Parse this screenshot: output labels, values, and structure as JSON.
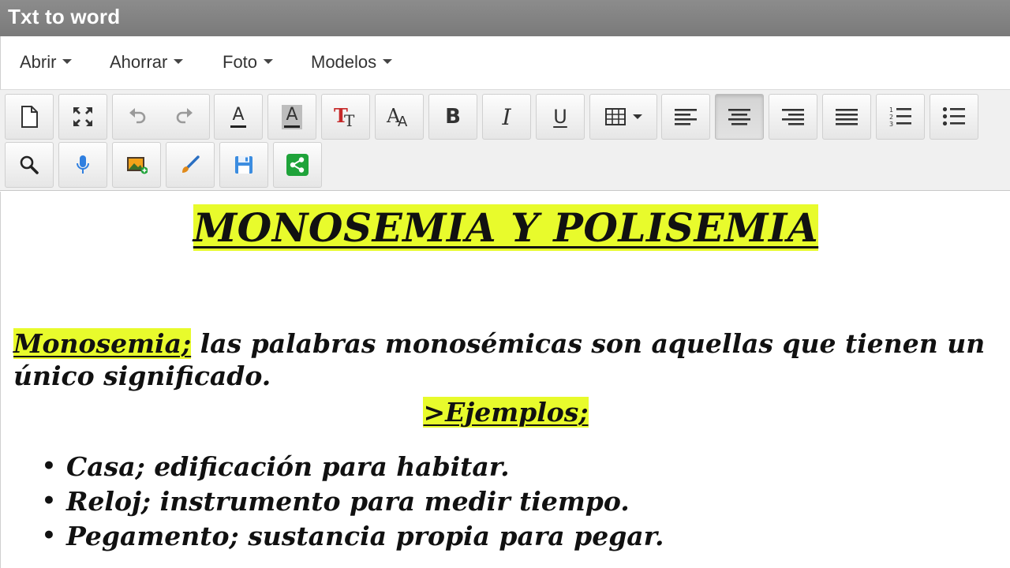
{
  "window": {
    "title": "Txt to word"
  },
  "menu": {
    "items": [
      {
        "label": "Abrir"
      },
      {
        "label": "Ahorrar"
      },
      {
        "label": "Foto"
      },
      {
        "label": "Modelos"
      }
    ]
  },
  "toolbar": {
    "row1": [
      {
        "name": "new-document"
      },
      {
        "name": "fullscreen"
      },
      {
        "name": "undo"
      },
      {
        "name": "redo"
      },
      {
        "name": "font-color",
        "glyph": "A"
      },
      {
        "name": "background-color",
        "glyph": "A"
      },
      {
        "name": "text-size",
        "glyph": "TT"
      },
      {
        "name": "font-family",
        "glyph": "AA"
      },
      {
        "name": "bold",
        "glyph": "B"
      },
      {
        "name": "italic",
        "glyph": "I"
      },
      {
        "name": "underline",
        "glyph": "U"
      },
      {
        "name": "table"
      },
      {
        "name": "align-left"
      },
      {
        "name": "align-center",
        "active": true
      },
      {
        "name": "align-right"
      },
      {
        "name": "align-justify"
      },
      {
        "name": "ordered-list"
      },
      {
        "name": "unordered-list"
      }
    ],
    "row2": [
      {
        "name": "search"
      },
      {
        "name": "microphone"
      },
      {
        "name": "insert-image"
      },
      {
        "name": "brush"
      },
      {
        "name": "save"
      },
      {
        "name": "share"
      }
    ]
  },
  "document": {
    "title": "MONOSEMIA Y POLISEMIA",
    "paragraph": {
      "term": "Monosemia;",
      "text": " las palabras monosémicas son aquellas que tienen un único significado."
    },
    "examples_heading": ">Ejemplos;",
    "examples": [
      {
        "text": "Casa; edificación para habitar."
      },
      {
        "text": "Reloj; instrumento para medir tiempo."
      },
      {
        "text": "Pegamento; sustancia propia para pegar."
      }
    ],
    "bullet": "•"
  },
  "colors": {
    "highlight": "#e8fb2c",
    "titlebar": "#808080",
    "toolbar_bg": "#f0f0f0",
    "share_green": "#1fa33a",
    "save_blue": "#3c8de0",
    "mic_blue": "#2f7fe0"
  }
}
